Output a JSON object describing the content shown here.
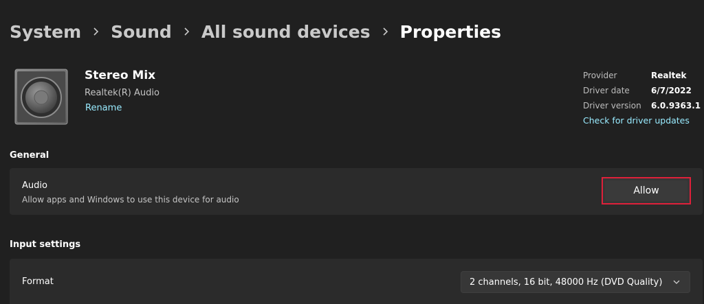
{
  "breadcrumb": {
    "items": [
      "System",
      "Sound",
      "All sound devices"
    ],
    "current": "Properties"
  },
  "device": {
    "icon": "speaker-icon",
    "name": "Stereo Mix",
    "subtitle": "Realtek(R) Audio",
    "rename_label": "Rename"
  },
  "driver": {
    "provider_label": "Provider",
    "provider_value": "Realtek",
    "date_label": "Driver date",
    "date_value": "6/7/2022",
    "version_label": "Driver version",
    "version_value": "6.0.9363.1",
    "update_link": "Check for driver updates"
  },
  "general": {
    "title": "General",
    "audio": {
      "title": "Audio",
      "description": "Allow apps and Windows to use this device for audio",
      "button_label": "Allow",
      "highlight_color": "#e0203a"
    }
  },
  "input_settings": {
    "title": "Input settings",
    "format": {
      "label": "Format",
      "value": "2 channels, 16 bit, 48000 Hz (DVD Quality)",
      "icon": "chevron-down-icon"
    }
  },
  "colors": {
    "background": "#202020",
    "card": "#2b2b2b",
    "accent_link": "#99ebff"
  }
}
